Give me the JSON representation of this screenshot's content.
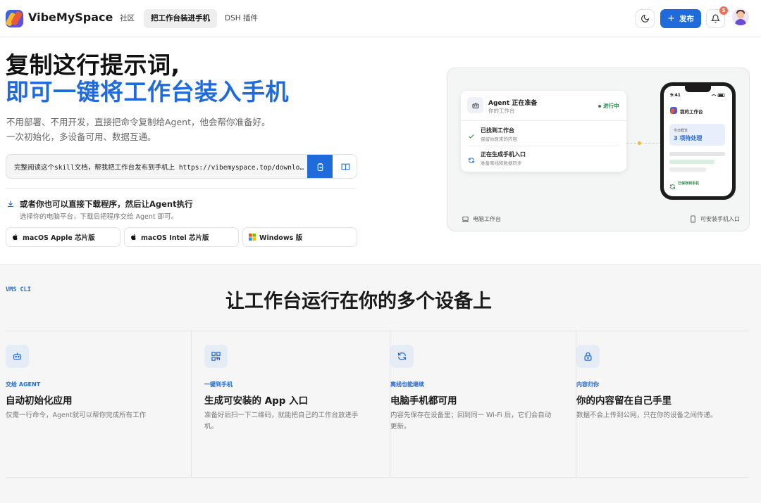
{
  "header": {
    "brand": "VibeMySpace",
    "tabs": [
      {
        "label": "社区"
      },
      {
        "label": "把工作台装进手机"
      },
      {
        "label": "DSH 插件"
      }
    ],
    "publish_label": "发布",
    "notification_count": "5"
  },
  "hero": {
    "title_line1": "复制这行提示词,",
    "title_line2": "即可一键将工作台装入手机",
    "subtitle_line1": "不用部署、不用开发，直接把命令复制给Agent，他会帮你准备好。",
    "subtitle_line2": "一次初始化，多设备可用、数据互通。",
    "command": "完整阅读这个skill文档，帮我把工作台发布到手机上 https://vibemyspace.top/download/vms-cli/SKILL.md",
    "download_title": "或者你也可以直接下载程序，然后让Agent执行",
    "download_subtitle": "选择你的电脑平台，下载后把程序交给 Agent 即可。",
    "os_buttons": [
      {
        "label": "macOS Apple 芯片版",
        "icon": "apple-icon"
      },
      {
        "label": "macOS Intel 芯片版",
        "icon": "apple-icon"
      },
      {
        "label": "Windows 版",
        "icon": "windows-icon"
      }
    ]
  },
  "preview": {
    "agent_title": "Agent 正在准备",
    "agent_subtitle": "你的工作台",
    "status": "进行中",
    "steps": [
      {
        "title": "已找到工作台",
        "subtitle": "保留你原来的内容",
        "icon": "check-icon"
      },
      {
        "title": "正在生成手机入口",
        "subtitle": "准备离线和数据同步",
        "icon": "refresh-icon"
      }
    ],
    "phone": {
      "time": "9:41",
      "title": "我的工作台",
      "card_label": "今日概览",
      "card_value": "3 项待处理",
      "footer": "已保存到本机"
    },
    "left_label": "电脑工作台",
    "right_label": "可安装手机入口"
  },
  "features": {
    "tag": "VMS CLI",
    "title": "让工作台运行在你的多个设备上",
    "items": [
      {
        "tag": "交给 AGENT",
        "title": "自动初始化应用",
        "desc": "仅需一行命令，Agent就可以帮你完成所有工作",
        "icon": "bot-icon"
      },
      {
        "tag": "一键到手机",
        "title": "生成可安装的 App 入口",
        "desc": "准备好后扫一下二维码，就能把自己的工作台放进手机。",
        "icon": "qr-code-icon"
      },
      {
        "tag": "离线也能继续",
        "title": "电脑手机都可用",
        "desc": "内容先保存在设备里；回到同一 Wi-Fi 后，它们会自动更新。",
        "icon": "refresh-icon"
      },
      {
        "tag": "内容归你",
        "title": "你的内容留在自己手里",
        "desc": "数据不会上传到公网，只在你的设备之间传递。",
        "icon": "lock-icon"
      }
    ]
  },
  "colors": {
    "accent": "#1f6bdb",
    "success": "#2b8a4a",
    "badge": "#f56c5b"
  }
}
